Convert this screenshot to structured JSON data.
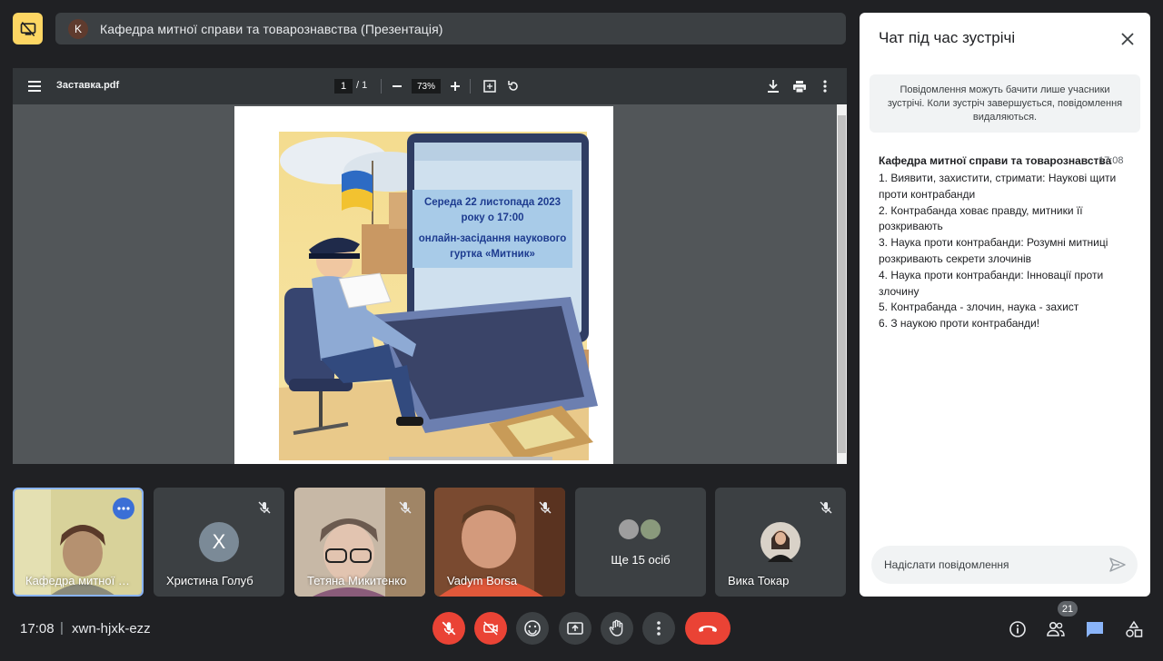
{
  "meeting": {
    "title": "Кафедра митної справи та товарознавства (Презентація)",
    "presenter_initial": "K",
    "time": "17:08",
    "separator": "|",
    "code": "xwn-hjxk-ezz"
  },
  "pdf": {
    "filename": "Заставка.pdf",
    "current_page": "1",
    "page_separator": "/ 1",
    "zoom": "73%",
    "poster": {
      "line1": "Середа 22 листопада 2023",
      "line2": "року о 17:00",
      "line3": "онлайн-засідання наукового",
      "line4": "гуртка «Митник»"
    }
  },
  "participants": [
    {
      "name": "Кафедра митної с...",
      "muted": false
    },
    {
      "name": "Христина Голуб",
      "initial": "X",
      "muted": true
    },
    {
      "name": "Тетяна Микитенко",
      "muted": true
    },
    {
      "name": "Vadym Borsa",
      "muted": true
    },
    {
      "name": "Ще 15 осіб"
    },
    {
      "name": "Вика Токар",
      "muted": true
    }
  ],
  "chat": {
    "title": "Чат під час зустрічі",
    "notice": "Повідомлення можуть бачити лише учасники зустрічі. Коли зустріч завершується, повідомлення видаляються.",
    "message": {
      "sender": "Кафедра митної справи та товарознавства",
      "time": "17:08",
      "lines": [
        "1. Виявити, захистити, стримати: Наукові щити проти контрабанди",
        "2. Контрабанда ховає правду, митники її розкривають",
        "3. Наука проти контрабанди: Розумні митниці розкривають секрети злочинів",
        "4. Наука проти контрабанди: Інновації проти злочину",
        "5. Контрабанда - злочин, наука - захист",
        "6. З наукою проти контрабанди!"
      ]
    },
    "input_placeholder": "Надіслати повідомлення"
  },
  "people_count": "21",
  "colors": {
    "background": "#202124",
    "tile": "#3c4043",
    "danger": "#ea4335",
    "accent_blue": "#8ab4f8",
    "present_yellow": "#fdd663",
    "active_tile_border": "#8ab4f8"
  }
}
